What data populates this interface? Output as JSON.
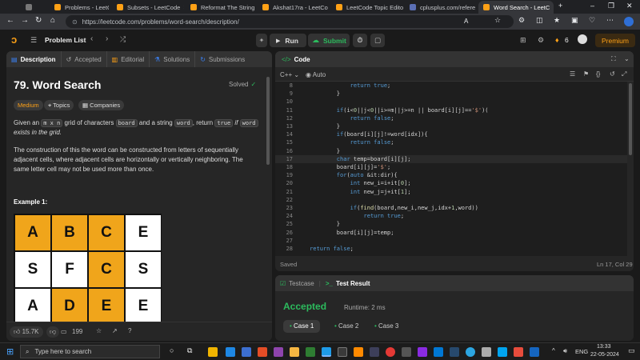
{
  "browser": {
    "tabs": [
      {
        "label": "Problems - LeetCode"
      },
      {
        "label": "Subsets - LeetCode"
      },
      {
        "label": "Reformat The String"
      },
      {
        "label": "Akshat17ra - LeetCo"
      },
      {
        "label": "LeetCode Topic Edito"
      },
      {
        "label": "cplusplus.com/refere"
      },
      {
        "label": "Word Search - LeetC"
      }
    ],
    "url": "https://leetcode.com/problems/word-search/description/"
  },
  "header": {
    "problem_list": "Problem List",
    "run": "Run",
    "submit": "Submit",
    "streak": "6",
    "premium": "Premium"
  },
  "description": {
    "tabs": [
      "Description",
      "Accepted",
      "Editorial",
      "Solutions",
      "Submissions"
    ],
    "title": "79. Word Search",
    "solved": "Solved",
    "difficulty": "Medium",
    "topics": "Topics",
    "companies": "Companies",
    "p1": {
      "a": "Given an ",
      "mxn": "m x n",
      "b": " grid of characters ",
      "board": "board",
      "c": " and a string ",
      "word": "word",
      "d": ", return ",
      "true": "true",
      "e": " if ",
      "word2": "word",
      "f": " exists in the grid."
    },
    "p2": "The construction of this the word can be constructed from letters of sequentially adjacent cells, where adjacent cells are horizontally or vertically neighboring. The same letter cell may not be used more than once.",
    "example": "Example 1:",
    "grid": [
      [
        {
          "ch": "A",
          "hl": true
        },
        {
          "ch": "B",
          "hl": true
        },
        {
          "ch": "C",
          "hl": true
        },
        {
          "ch": "E",
          "hl": false
        }
      ],
      [
        {
          "ch": "S",
          "hl": false
        },
        {
          "ch": "F",
          "hl": false
        },
        {
          "ch": "C",
          "hl": true
        },
        {
          "ch": "S",
          "hl": false
        }
      ],
      [
        {
          "ch": "A",
          "hl": false
        },
        {
          "ch": "D",
          "hl": true
        },
        {
          "ch": "E",
          "hl": true
        },
        {
          "ch": "E",
          "hl": false
        }
      ]
    ],
    "likes": "15.7K",
    "comments": "199"
  },
  "code": {
    "title": "Code",
    "language": "C++",
    "mode": "Auto",
    "status": "Saved",
    "cursor": "Ln 17, Col 29",
    "lines": [
      {
        "n": "8",
        "t": "            return true;"
      },
      {
        "n": "9",
        "t": "        }"
      },
      {
        "n": "10",
        "t": ""
      },
      {
        "n": "11",
        "t": "        if(i<0||j<0||i>=m||j>=n || board[i][j]=='$')("
      },
      {
        "n": "12",
        "t": "            return false;"
      },
      {
        "n": "13",
        "t": "        }"
      },
      {
        "n": "14",
        "t": "        if(board[i][j]!=word[idx]){"
      },
      {
        "n": "15",
        "t": "            return false;"
      },
      {
        "n": "16",
        "t": "        }"
      },
      {
        "n": "17",
        "t": "        char temp=board[i][j];"
      },
      {
        "n": "18",
        "t": "        board[i][j]='$';"
      },
      {
        "n": "19",
        "t": "        for(auto &it:dir){"
      },
      {
        "n": "20",
        "t": "            int new_i=i+it[0];"
      },
      {
        "n": "21",
        "t": "            int new_j=j+it[1];"
      },
      {
        "n": "22",
        "t": ""
      },
      {
        "n": "23",
        "t": "            if(find(board,new_i,new_j,idx+1,word))"
      },
      {
        "n": "24",
        "t": "                return true;"
      },
      {
        "n": "25",
        "t": "        }"
      },
      {
        "n": "26",
        "t": "        board[i][j]=temp;"
      },
      {
        "n": "27",
        "t": ""
      },
      {
        "n": "28",
        "t": "return false;"
      }
    ]
  },
  "result": {
    "tabs": [
      "Testcase",
      "Test Result"
    ],
    "status": "Accepted",
    "runtime": "Runtime: 2 ms",
    "cases": [
      "Case 1",
      "Case 2",
      "Case 3"
    ]
  },
  "taskbar": {
    "search": "Type here to search",
    "lang": "ENG",
    "time": "13:33",
    "date": "22-05-2024"
  },
  "colors": {
    "accent_orange": "#ffa116",
    "accepted_green": "#2cbb5d",
    "grid_highlight": "#f0a51b"
  }
}
